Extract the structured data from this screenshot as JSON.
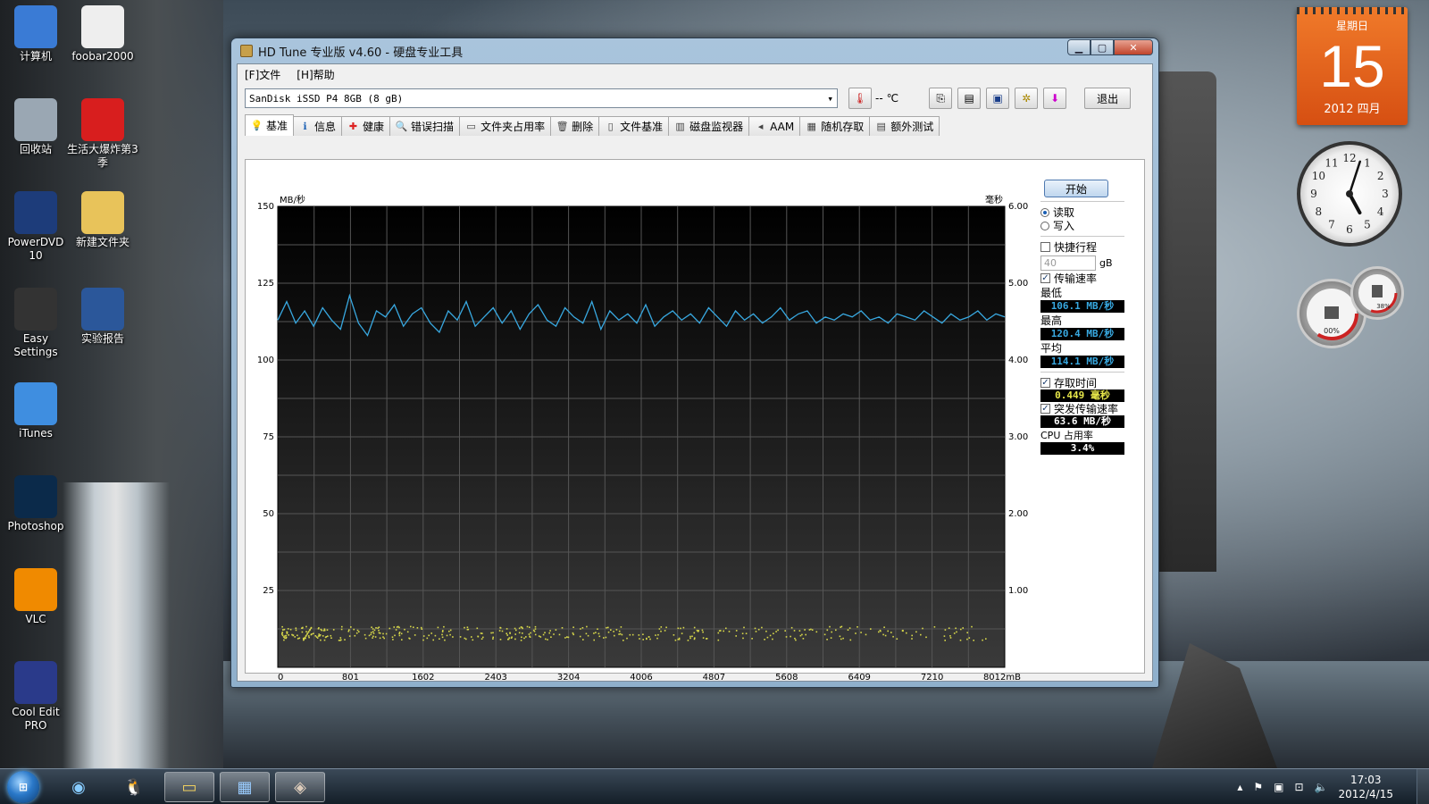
{
  "desktop": {
    "icons": [
      {
        "label": "计算机",
        "icon": "computer-icon",
        "color": "#3a7bd5"
      },
      {
        "label": "foobar2000",
        "icon": "foobar-icon",
        "color": "#eeeeee"
      },
      {
        "label": "回收站",
        "icon": "recycle-bin-icon",
        "color": "#9aa7b3"
      },
      {
        "label": "生活大爆炸第3季",
        "icon": "video-file-icon",
        "color": "#d81e1e"
      },
      {
        "label": "PowerDVD 10",
        "icon": "powerdvd-icon",
        "color": "#1d3c7a"
      },
      {
        "label": "新建文件夹",
        "icon": "folder-icon",
        "color": "#e8c35a"
      },
      {
        "label": "Easy Settings",
        "icon": "easy-settings-icon",
        "color": "#333333"
      },
      {
        "label": "实验报告",
        "icon": "word-doc-icon",
        "color": "#2b579a"
      },
      {
        "label": "iTunes",
        "icon": "itunes-icon",
        "color": "#3f8ee0"
      },
      {
        "label": "Photoshop",
        "icon": "photoshop-icon",
        "color": "#0b2a4a"
      },
      {
        "label": "VLC",
        "icon": "vlc-icon",
        "color": "#f08a00"
      },
      {
        "label": "Cool Edit PRO",
        "icon": "cool-edit-icon",
        "color": "#2a3a8a"
      }
    ]
  },
  "window": {
    "title": "HD Tune 专业版 v4.60 - 硬盘专业工具",
    "menu": [
      "[F]文件",
      "[H]帮助"
    ],
    "drive": "SanDisk iSSD P4 8GB       (8 gB)",
    "temperature": "--",
    "temp_unit": "℃",
    "exit_label": "退出",
    "tabs": [
      {
        "label": "基准",
        "icon": "bulb-icon",
        "active": true
      },
      {
        "label": "信息",
        "icon": "info-icon"
      },
      {
        "label": "健康",
        "icon": "health-cross-icon"
      },
      {
        "label": "错误扫描",
        "icon": "magnifier-icon"
      },
      {
        "label": "文件夹占用率",
        "icon": "folder-icon"
      },
      {
        "label": "删除",
        "icon": "trash-icon"
      },
      {
        "label": "文件基准",
        "icon": "file-benchmark-icon"
      },
      {
        "label": "磁盘监视器",
        "icon": "disk-monitor-icon"
      },
      {
        "label": "AAM",
        "icon": "speaker-icon"
      },
      {
        "label": "随机存取",
        "icon": "random-access-icon"
      },
      {
        "label": "额外测试",
        "icon": "extra-tests-icon"
      }
    ],
    "side": {
      "start_label": "开始",
      "read_label": "读取",
      "write_label": "写入",
      "short_stroke_label": "快捷行程",
      "short_stroke_value": "40",
      "short_stroke_unit": "gB",
      "transfer_label": "传输速率",
      "min_label": "最低",
      "min_value": "106.1 MB/秒",
      "max_label": "最高",
      "max_value": "120.4 MB/秒",
      "avg_label": "平均",
      "avg_value": "114.1 MB/秒",
      "access_label": "存取时间",
      "access_value": "0.449 毫秒",
      "burst_label": "突发传输速率",
      "burst_value": "63.6 MB/秒",
      "cpu_label": "CPU 占用率",
      "cpu_value": "3.4%"
    }
  },
  "chart_data": {
    "type": "line",
    "ylabel_left": "MB/秒",
    "ylabel_right": "毫秒",
    "xunit": "mB",
    "ylim_left": [
      0,
      150
    ],
    "ylim_right": [
      0,
      6.0
    ],
    "xlim": [
      0,
      8012
    ],
    "y_ticks_left": [
      "150",
      "125",
      "100",
      "75",
      "50",
      "25"
    ],
    "y_ticks_right": [
      "6.00",
      "5.00",
      "4.00",
      "3.00",
      "2.00",
      "1.00"
    ],
    "x_ticks": [
      "0",
      "801",
      "1602",
      "2403",
      "3204",
      "4006",
      "4807",
      "5608",
      "6409",
      "7210",
      "8012mB"
    ],
    "grid": true,
    "series": [
      {
        "values_mbps": [
          113,
          119,
          112,
          116,
          111,
          117,
          113,
          110,
          121,
          112,
          108,
          116,
          114,
          118,
          111,
          115,
          117,
          112,
          109,
          116,
          113,
          119,
          111,
          114,
          117,
          112,
          116,
          110,
          115,
          118,
          113,
          111,
          117,
          114,
          112,
          119,
          110,
          116,
          113,
          115,
          112,
          118,
          111,
          114,
          116,
          113,
          115,
          112,
          117,
          114,
          111,
          116,
          113,
          115,
          112,
          114,
          117,
          113,
          115,
          116,
          112,
          114,
          113,
          115,
          114,
          116,
          113,
          114,
          112,
          115,
          114,
          113,
          116,
          114,
          112,
          115,
          113,
          114,
          116,
          113,
          115,
          114
        ]
      },
      {
        "access_ms_min": 0.32,
        "access_ms_max": 0.62,
        "access_ms_typical": 0.45
      }
    ],
    "colors": {
      "transfer": "#38a8e0",
      "access": "#d8d84a",
      "background_top": "#000000",
      "background_bottom": "#3a3a3a"
    }
  },
  "gadgets": {
    "calendar": {
      "weekday": "星期日",
      "day": "15",
      "month": "2012 四月"
    },
    "clock": {
      "hour": 5,
      "minute": 3
    },
    "meter": {
      "cpu": "00%",
      "memory": "38%"
    }
  },
  "taskbar": {
    "items": [
      {
        "icon": "windows-start-icon"
      },
      {
        "icon": "media-player-icon"
      },
      {
        "icon": "qq-icon"
      },
      {
        "icon": "explorer-folder-icon"
      },
      {
        "icon": "control-panel-icon"
      },
      {
        "icon": "hdtune-icon"
      }
    ],
    "time": "17:03",
    "date": "2012/4/15"
  }
}
